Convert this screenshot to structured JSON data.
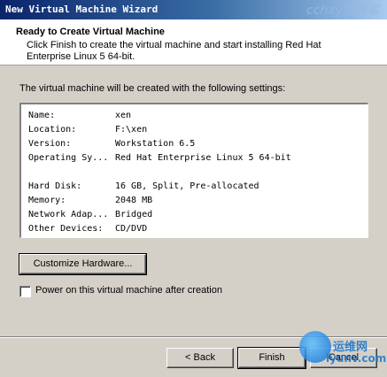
{
  "window": {
    "title": "New Virtual Machine Wizard"
  },
  "watermark": {
    "top_text": "cchxy的博客",
    "logo_text": "运维网",
    "logo_url": "iyunv.com"
  },
  "header": {
    "title": "Ready to Create Virtual Machine",
    "subtitle": "Click Finish to create the virtual machine and start installing Red Hat Enterprise Linux 5 64-bit."
  },
  "intro_text": "The virtual machine will be created with the following settings:",
  "settings": [
    {
      "key": "Name:",
      "value": "xen"
    },
    {
      "key": "Location:",
      "value": "F:\\xen"
    },
    {
      "key": "Version:",
      "value": "Workstation 6.5"
    },
    {
      "key": "Operating Sy...",
      "value": "Red Hat Enterprise Linux 5 64-bit"
    },
    {
      "key": "Hard Disk:",
      "value": "16 GB, Split, Pre-allocated"
    },
    {
      "key": "Memory:",
      "value": "2048 MB"
    },
    {
      "key": "Network Adap...",
      "value": "Bridged"
    },
    {
      "key": "Other Devices:",
      "value": "CD/DVD"
    }
  ],
  "buttons": {
    "customize": "Customize Hardware...",
    "back": "< Back",
    "finish": "Finish",
    "cancel": "Cancel"
  },
  "power_on_checkbox": {
    "label": "Power on this virtual machine after creation",
    "checked": false
  }
}
